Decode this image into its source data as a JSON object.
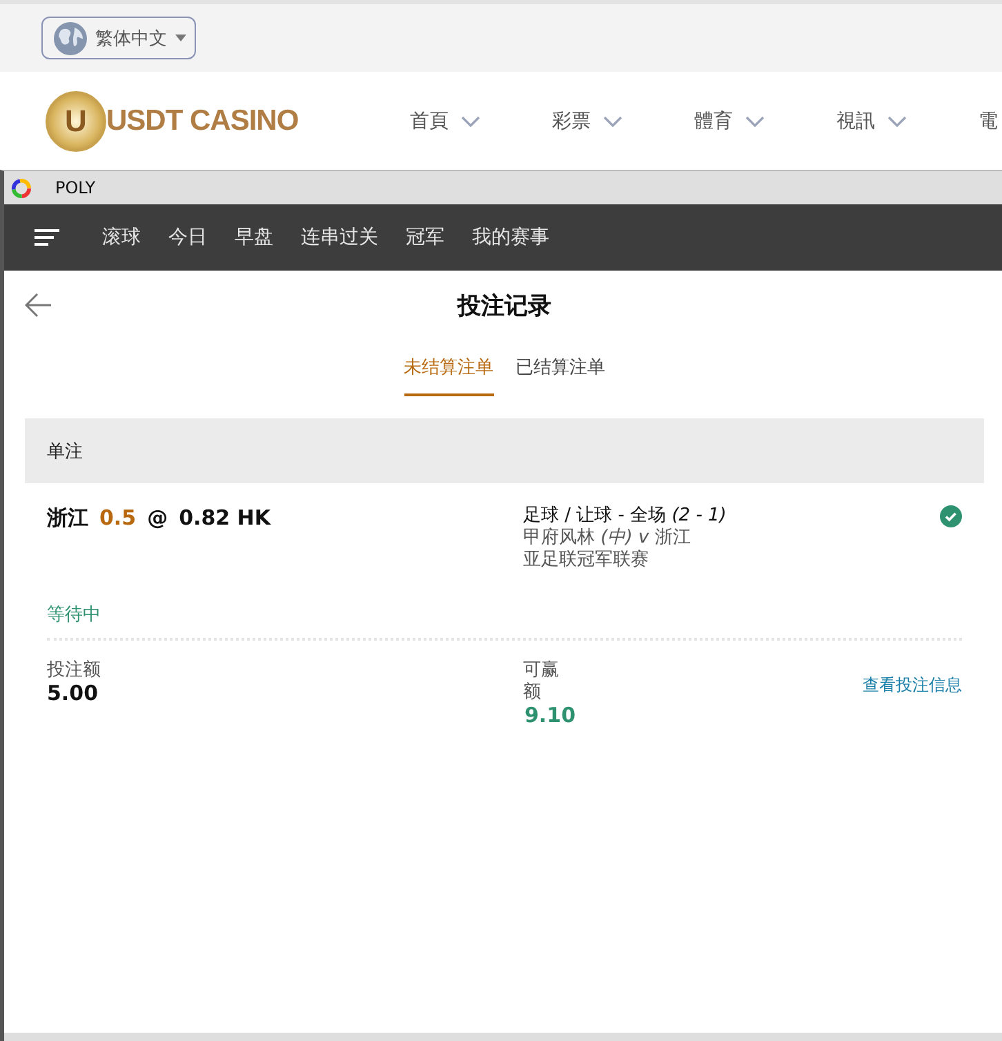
{
  "top_bar": {
    "language": "繁体中文"
  },
  "site_header": {
    "logo_mark": "U",
    "logo_text": "USDT CASINO",
    "nav": [
      {
        "label": "首頁",
        "dropdown": true
      },
      {
        "label": "彩票",
        "dropdown": true
      },
      {
        "label": "體育",
        "dropdown": true
      },
      {
        "label": "視訊",
        "dropdown": true
      },
      {
        "label": "電",
        "dropdown": false
      }
    ]
  },
  "window": {
    "title": "POLY"
  },
  "menu": [
    "滚球",
    "今日",
    "早盘",
    "连串过关",
    "冠军",
    "我的赛事"
  ],
  "page": {
    "title": "投注记录"
  },
  "tabs": [
    {
      "label": "未结算注单",
      "selected": true
    },
    {
      "label": "已结算注单",
      "selected": false
    }
  ],
  "section": {
    "title": "单注"
  },
  "bets": [
    {
      "selection": "浙江",
      "handicap": "0.5",
      "at": "@",
      "odds": "0.82 HK",
      "market": "足球 / 让球 - 全场 *(2 - 1)*",
      "match": "甲府风林 *(中)* *v* 浙江",
      "league": "亚足联冠军联赛",
      "confirmed": true,
      "status": "等待中",
      "stake_label": "投注额",
      "stake": "5.00",
      "payout_label": "可赢额",
      "payout": "9.10",
      "link": "查看投注信息"
    }
  ]
}
